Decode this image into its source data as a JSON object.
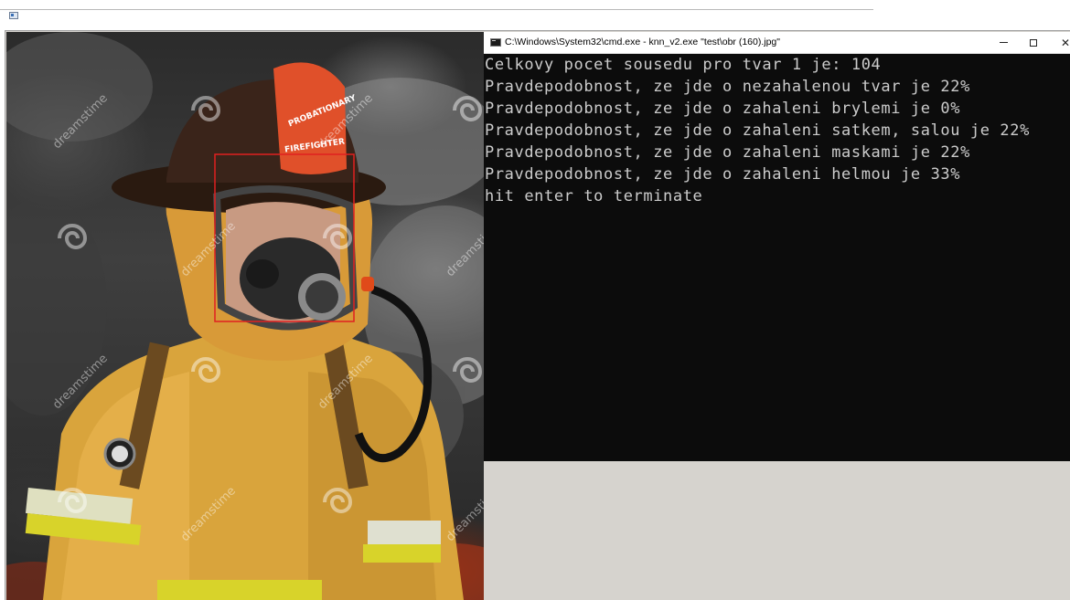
{
  "terminal": {
    "title": "C:\\Windows\\System32\\cmd.exe - knn_v2.exe \"test\\obr (160).jpg\"",
    "lines": [
      "Celkovy pocet sousedu pro tvar 1 je: 104",
      "Pravdepodobnost, ze jde o nezahalenou tvar je 22%",
      "Pravdepodobnost, ze jde o zahaleni brylemi je 0%",
      "Pravdepodobnost, ze jde o zahaleni satkem, salou je 22%",
      "Pravdepodobnost, ze jde o zahaleni maskami je 22%",
      "Pravdepodobnost, ze jde o zahaleni helmou je 33%",
      "hit enter to terminate"
    ],
    "colors": {
      "background": "#0c0c0c",
      "text": "#cccccc"
    }
  },
  "photo": {
    "watermark_text": "dreamstime",
    "helmet_front_text_top": "PROBATIONARY",
    "helmet_front_text_bottom": "FIREFIGHTER",
    "detection_box_color": "#e02020"
  },
  "icons": [
    "window-app-icon",
    "cmd-icon",
    "minimize-icon",
    "maximize-icon",
    "close-icon",
    "dreamstime-logo-icon"
  ]
}
